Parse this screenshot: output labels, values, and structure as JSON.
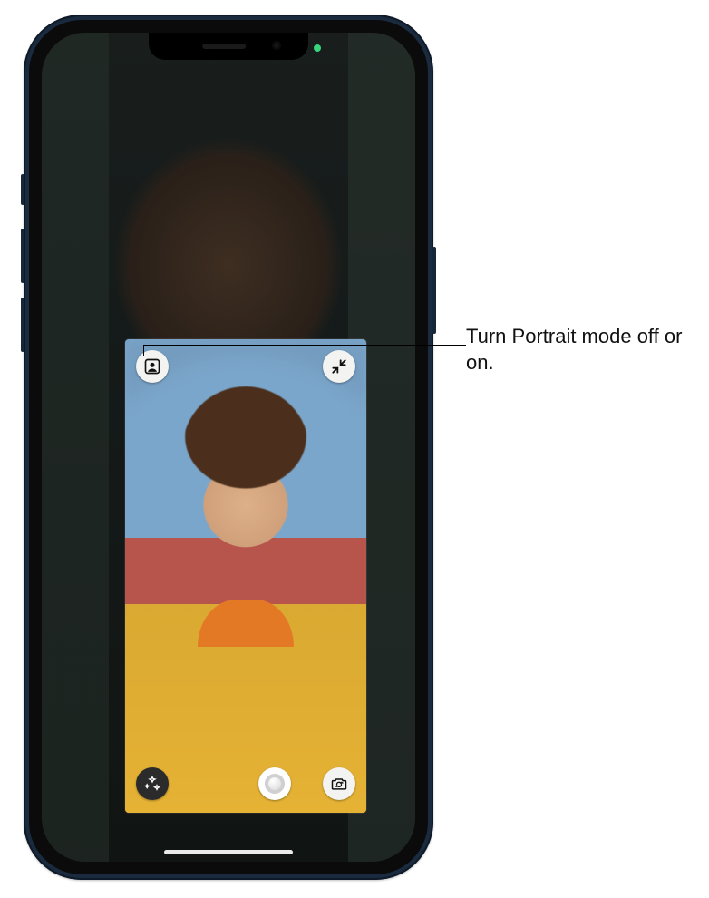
{
  "callout": {
    "text": "Turn Portrait mode off or on."
  },
  "status": {
    "camera_indicator": "on"
  },
  "self_tile": {
    "buttons": {
      "portrait": {
        "name": "portrait-mode-toggle",
        "icon": "person-portrait-icon"
      },
      "minimize": {
        "name": "minimize-tile-button",
        "icon": "arrows-in-icon"
      },
      "effects": {
        "name": "effects-button",
        "icon": "sparkle-aperture-icon"
      },
      "shutter": {
        "name": "capture-photo-button",
        "icon": "shutter-icon"
      },
      "cameraFlip": {
        "name": "flip-camera-button",
        "icon": "camera-flip-icon"
      }
    }
  }
}
